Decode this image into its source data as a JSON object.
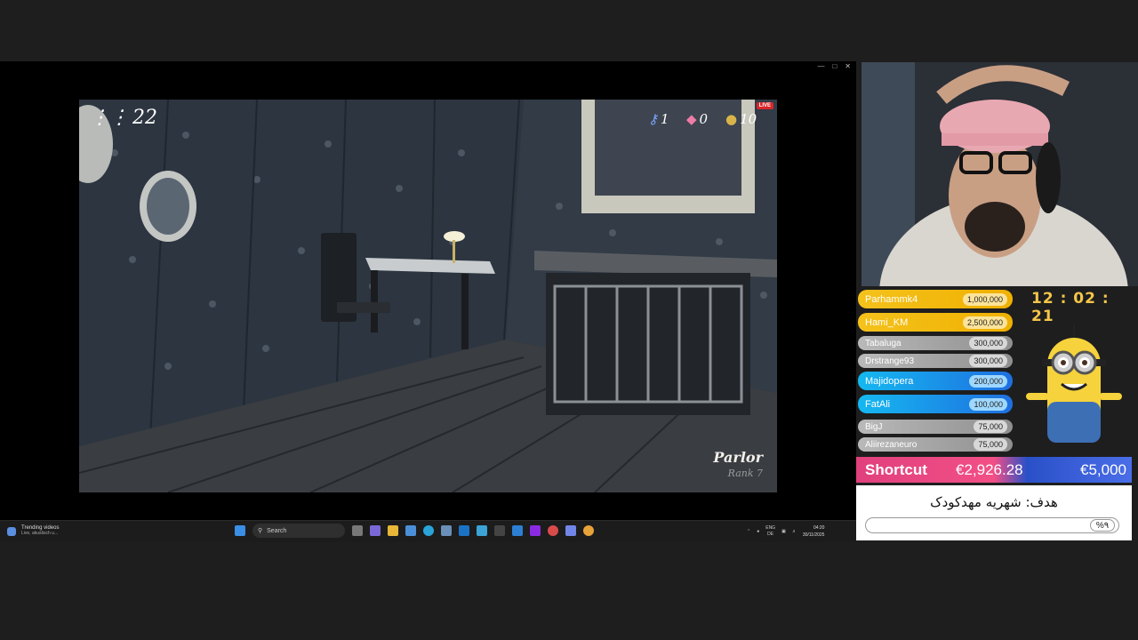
{
  "game": {
    "steps": "22",
    "keys": "1",
    "gems": "0",
    "coins": "10",
    "live_badge": "LIVE",
    "room_name": "Parlor",
    "room_rank": "Rank 7"
  },
  "taskbar": {
    "news_title": "Trending videos",
    "news_sub": "Live, akustisch u...",
    "search_placeholder": "Search",
    "lang_top": "ENG",
    "lang_bottom": "DE",
    "time": "04:20",
    "date": "30/11/2025"
  },
  "leaderboard": [
    {
      "name": "Parhammk4",
      "amount": "1,000,000",
      "tier": "gold"
    },
    {
      "name": "Hami_KM",
      "amount": "2,500,000",
      "tier": "gold"
    },
    {
      "name": "Tabaluga",
      "amount": "300,000",
      "tier": "silver"
    },
    {
      "name": "Drstrange93",
      "amount": "300,000",
      "tier": "silver"
    },
    {
      "name": "Majidopera",
      "amount": "200,000",
      "tier": "blue"
    },
    {
      "name": "FatAli",
      "amount": "100,000",
      "tier": "blue"
    },
    {
      "name": "BigJ",
      "amount": "75,000",
      "tier": "silver"
    },
    {
      "name": "Aliirezaneuro",
      "amount": "75,000",
      "tier": "silver"
    }
  ],
  "stream_timer": "12 : 02 : 21",
  "donation": {
    "label": "Shortcut",
    "current": "€2,926.28",
    "goal": "€5,000"
  },
  "goal_panel": {
    "text": "هدف: شهریه مهدکودک",
    "percent": "%۹"
  },
  "colors": {
    "gold": "#f5c21c",
    "silver": "#9c9c9c",
    "blue": "#1e8fe6",
    "pink": "#f24f86",
    "blue_bar": "#2a50c8"
  }
}
